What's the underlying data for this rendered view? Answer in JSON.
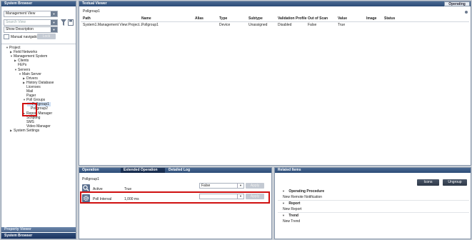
{
  "browser": {
    "title": "System Browser",
    "view_value": "Management View",
    "search_placeholder": "Search View",
    "description_value": "Show Description",
    "manual_nav_label": "Manual navigation",
    "lock_label": "Lock",
    "tree": [
      {
        "label": "Project",
        "level": 0,
        "expander": "open"
      },
      {
        "label": "Field Networks",
        "level": 1,
        "expander": "closed"
      },
      {
        "label": "Management System",
        "level": 1,
        "expander": "open"
      },
      {
        "label": "Clients",
        "level": 2,
        "expander": "closed"
      },
      {
        "label": "FEPs",
        "level": 2,
        "expander": "none"
      },
      {
        "label": "Servers",
        "level": 2,
        "expander": "open"
      },
      {
        "label": "Main Server",
        "level": 3,
        "expander": "open"
      },
      {
        "label": "Drivers",
        "level": 4,
        "expander": "closed"
      },
      {
        "label": "History Database",
        "level": 4,
        "expander": "closed"
      },
      {
        "label": "Licenses",
        "level": 4,
        "expander": "none"
      },
      {
        "label": "Mail",
        "level": 4,
        "expander": "none"
      },
      {
        "label": "Pager",
        "level": 4,
        "expander": "none"
      },
      {
        "label": "Poll Groups",
        "level": 4,
        "expander": "open"
      },
      {
        "label": "Pollgroup1",
        "level": 5,
        "expander": "none",
        "selected": true
      },
      {
        "label": "Pollgroup2",
        "level": 5,
        "expander": "none"
      },
      {
        "label": "Report Manager",
        "level": 4,
        "expander": "closed"
      },
      {
        "label": "Scripting",
        "level": 4,
        "expander": "none"
      },
      {
        "label": "SMS",
        "level": 4,
        "expander": "none"
      },
      {
        "label": "Video Manager",
        "level": 4,
        "expander": "none"
      },
      {
        "label": "System Settings",
        "level": 1,
        "expander": "closed"
      }
    ],
    "bottom_tabs": [
      "Property Viewer",
      "System Browser"
    ]
  },
  "textual": {
    "title": "Textual Viewer",
    "mode": "Operating",
    "breadcrumb": "Pollgroup1",
    "columns": [
      "Path",
      "Name",
      "Alias",
      "Type",
      "Subtype",
      "Validation Profile",
      "Out of Scan",
      "Value",
      "Image",
      "Status"
    ],
    "rows": [
      [
        "System1.Management View:Project....",
        "Pollgroup1",
        "",
        "Device",
        "Unassigned",
        "Disabled",
        "False",
        "True",
        "",
        ""
      ]
    ]
  },
  "operation": {
    "tabs": [
      "Operation",
      "Extended Operation",
      "Detailed Log"
    ],
    "object_name": "Pollgroup1",
    "rows": [
      {
        "label": "Active",
        "value": "True",
        "select_value": "False",
        "apply": "Apply"
      },
      {
        "label": "Poll Interval",
        "value": "1,000 ms",
        "select_value": "",
        "apply": "Apply"
      }
    ]
  },
  "related": {
    "title": "Related Items",
    "icons_label": "Icons",
    "ungroup_label": "Ungroup",
    "groups": [
      {
        "name": "Operating Procedure",
        "items": [
          "New Remote Notification"
        ]
      },
      {
        "name": "Report",
        "items": [
          "New Report"
        ]
      },
      {
        "name": "Trend",
        "items": [
          "New Trend"
        ]
      }
    ]
  }
}
